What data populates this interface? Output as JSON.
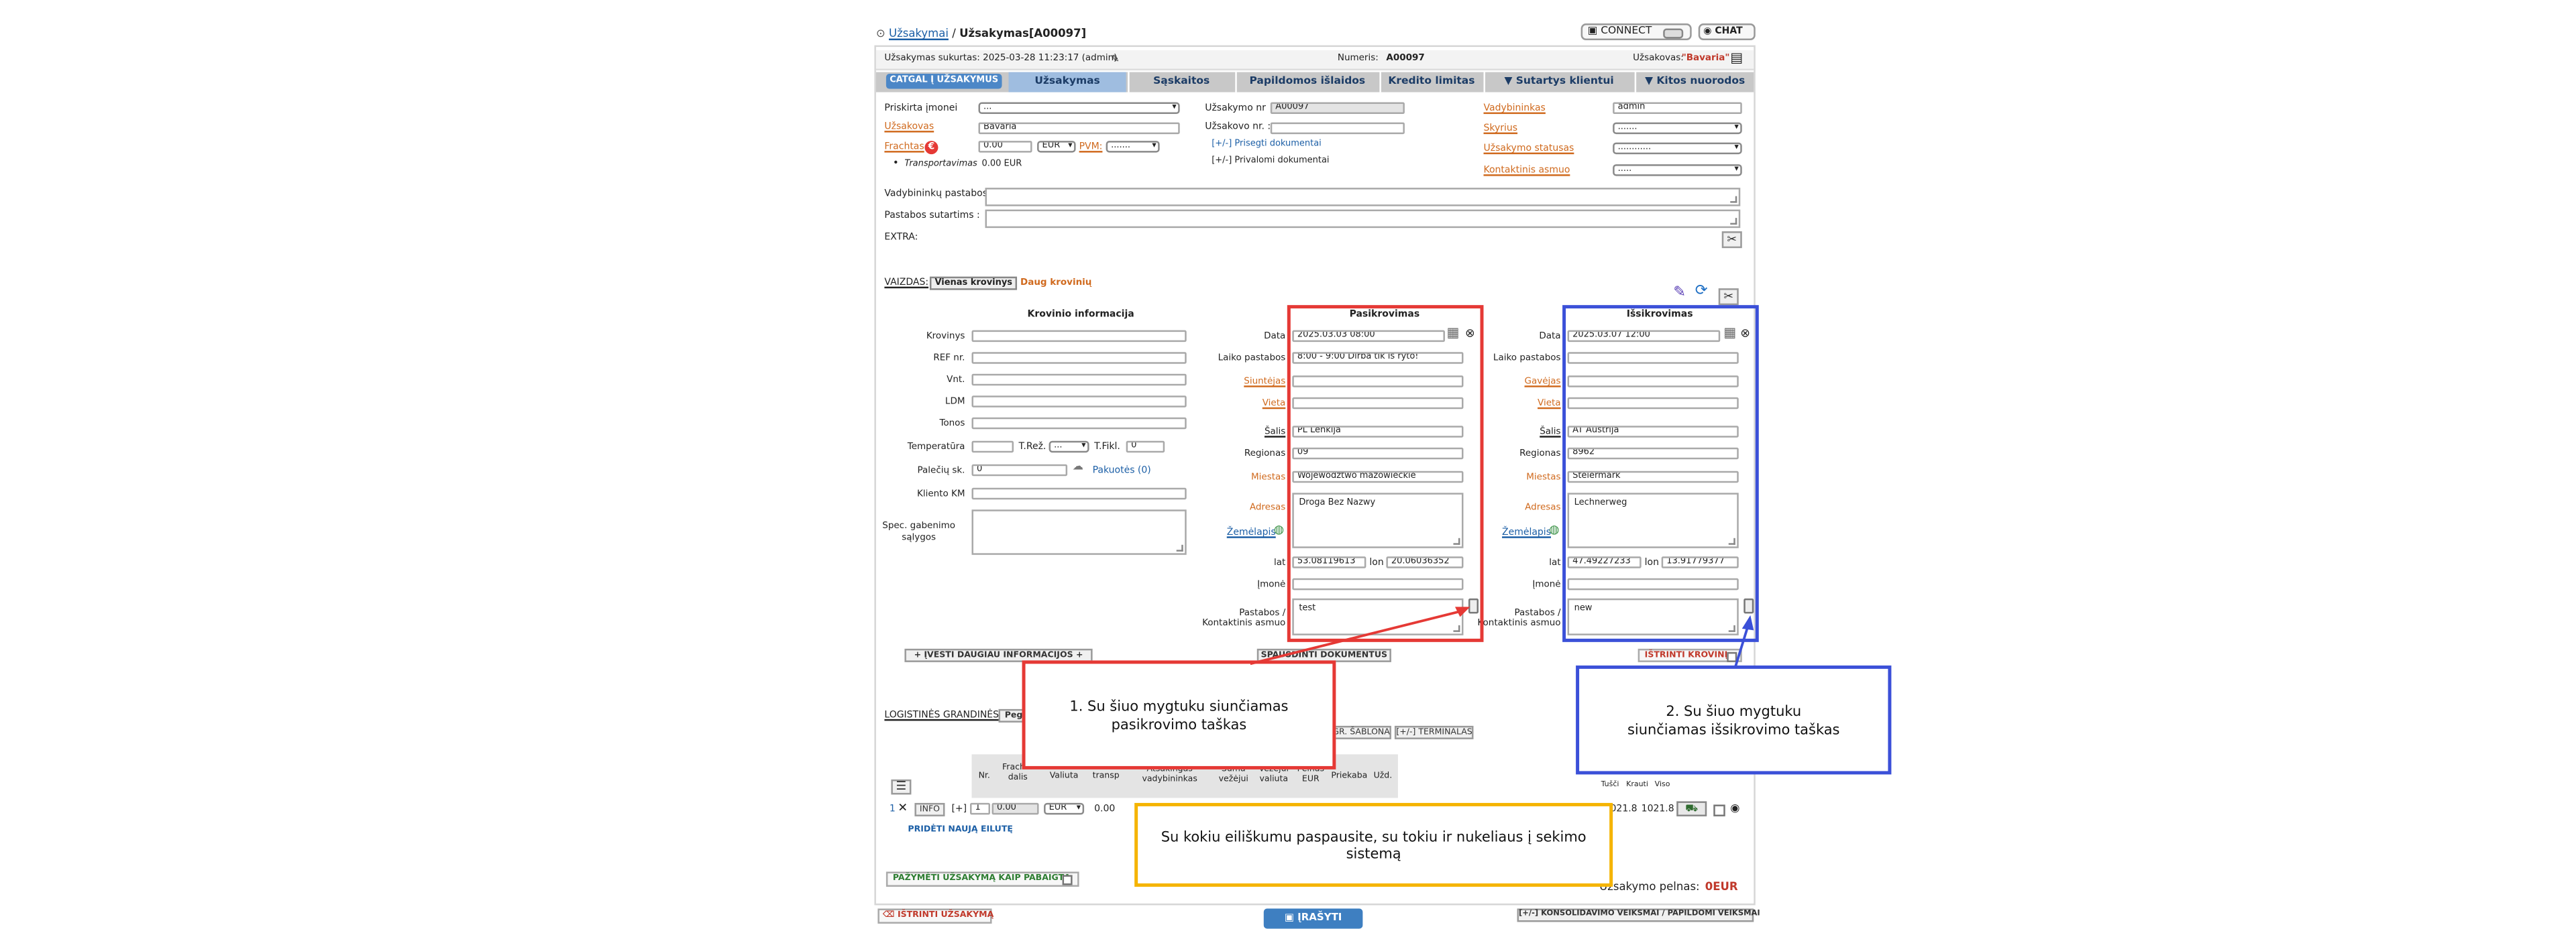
{
  "breadcrumb": {
    "parent": "Užsakymai",
    "separator": "/",
    "current": "Užsakymas[A00097]"
  },
  "topbar": {
    "connect": "CONNECT",
    "chat": "CHAT"
  },
  "info_bar": {
    "created": "Užsakymas sukurtas: 2025-03-28 11:23:17 (admin)",
    "number_label": "Numeris:",
    "number": "A00097",
    "client_label": "Užsakovas:",
    "client": "\"Bavaria\""
  },
  "tabs": [
    "CATGAL Į UŽSAKYMUS",
    "Užsakymas",
    "Sąskaitos",
    "Papildomos išlaidos",
    "Kredito limitas",
    "▼ Sutartys klientui",
    "▼ Kitos nuorodos"
  ],
  "order": {
    "company_label": "Priskirta įmonei",
    "company_value": "...",
    "client_label": "Užsakovas",
    "client_value": "Bavaria",
    "freight_label": "Frachtas",
    "freight_value": "0.00",
    "currency": "EUR",
    "vat_label": "PVM:",
    "vat_value": ".......",
    "transport_label": "Transportavimas",
    "transport_value": "0.00 EUR",
    "order_nr_label": "Užsakymo nr",
    "order_nr": "A00097",
    "client_order_label": "Užsakovo nr. :",
    "attach_docs": "[+/-] Prisegti dokumentai",
    "mandatory_docs": "[+/-] Privalomi dokumentai",
    "manager_label": "Vadybininkas",
    "manager": "admin",
    "department_label": "Skyrius",
    "department": ".......",
    "status_label": "Užsakymo statusas",
    "status": "............",
    "contact_label": "Kontaktinis asmuo",
    "contact": "....."
  },
  "notes": {
    "manager_notes": "Vadybininkų pastabos :",
    "contract_notes": "Pastabos sutartims :",
    "extra": "EXTRA:"
  },
  "view": {
    "label": "VAIZDAS:",
    "single": "Vienas krovinys",
    "multi": "Daug krovinių"
  },
  "cargo": {
    "title": "Krovinio informacija",
    "labels": [
      "Krovinys",
      "REF nr.",
      "Vnt.",
      "LDM",
      "Tonos"
    ],
    "temp_label": "Temperatūra",
    "temp_mode_label": "T.Rež.",
    "temp_mode_value": "...",
    "temp_fixed_label": "T.Fikl.",
    "temp_fixed_value": "0",
    "pallets_label": "Palečių sk.",
    "pallets_value": "0",
    "packaging": "Pakuotės (0)",
    "client_km": "Kliento KM",
    "special_label": "Spec. gabenimo sąlygos"
  },
  "loading": {
    "title": "Pasikrovimas",
    "date_label": "Data",
    "date": "2025.03.03 08:00",
    "time_notes_label": "Laiko pastabos",
    "time_notes": "8:00 - 9:00 Dirba tik iš ryto!",
    "sender_label": "Siuntėjas",
    "place_label": "Vieta",
    "country_label": "Šalis",
    "country": "PL Lenkija",
    "region_label": "Regionas",
    "region": "09",
    "city_label": "Miestas",
    "city": "Województwo mazowieckie",
    "address_label": "Adresas",
    "address": "Droga Bez Nazwy",
    "map_label": "Žemėlapis",
    "lat_label": "lat",
    "lat": "53.08119613",
    "lon_label": "lon",
    "lon": "20.06036352",
    "company_label": "Įmonė",
    "notes_label": "Pastabos /",
    "contact_label": "Kontaktinis asmuo",
    "notes": "test"
  },
  "unloading": {
    "title": "Išsikrovimas",
    "date_label": "Data",
    "date": "2025.03.07 12:00",
    "time_notes_label": "Laiko pastabos",
    "receiver_label": "Gavėjas",
    "place_label": "Vieta",
    "country_label": "Šalis",
    "country": "AT Austrija",
    "region_label": "Regionas",
    "region": "8962",
    "city_label": "Miestas",
    "city": "Steiermark",
    "address_label": "Adresas",
    "address": "Lechnerweg",
    "map_label": "Žemėlapis",
    "lat_label": "lat",
    "lat": "47.49227233",
    "lon_label": "lon",
    "lon": "13.91779377",
    "company_label": "Įmonė",
    "notes_label": "Pastabos /",
    "contact_label": "Kontaktinis asmuo",
    "notes": "new"
  },
  "actions": {
    "more_info": "+ ĮVESTI DAUGIAU INFORMACIJOS +",
    "print_docs": "SPAUSDINTI DOKUMENTUS",
    "delete_cargo": "IŠTRINTI KROVINĮ",
    "save": "ĮRAŠYTI",
    "delete_order": "IŠTRINTI UŽSAKYMĄ",
    "mark_done": "PAŽYMĖTI UŽSAKYMĄ KAIP PABAIGTĄ",
    "consolidation": "[+/-] KONSOLIDAVIMO VEIKSMAI / PAPILDOMI VEIKSMAI"
  },
  "logistics": {
    "label": "LOGISTINĖS GRANDINĖS:",
    "button": "Peg",
    "template_btn": "GR. ŠABLONA",
    "terminals_btn": "[+/-] TERMINALAS",
    "headers": [
      "Nr.",
      "Frachto dalis",
      "Valiuta",
      "Dalis už transp",
      "Atsakingas vadybininkas",
      "Suma vežėjui",
      "Vežėjui valiuta",
      "Pelnas EUR",
      "Priekaba",
      "Užd."
    ],
    "right_headers": [
      "Tušči",
      "Krauti",
      "Viso"
    ],
    "row": {
      "nr": "1",
      "info": "INFO",
      "plus": "[+]",
      "index": "1",
      "share": "0.00",
      "currency": "EUR",
      "transport": "0.00",
      "empty": "1021.8",
      "loaded": "1021.8"
    },
    "add_row": "PRIDĖTI NAUJĄ EILUTĘ",
    "profit_label": "Užsakymo pelnas:",
    "profit": "0EUR"
  },
  "callouts": {
    "c1": "1. Su šiuo mygtuku siunčiamas pasikrovimo taškas",
    "c2": "2. Su šiuo mygtuku siunčiamas išsikrovimo taškas",
    "c3": "Su kokiu eiliškumu paspausite, su tokiu ir nukeliaus į sekimo sistemą"
  },
  "colors": {
    "red": "#e53935",
    "blue": "#3b50d8",
    "yellow": "#f5b400",
    "tab_bar": "#c8c8c8",
    "link": "#1c5fa6",
    "required": "#d06a1e"
  }
}
